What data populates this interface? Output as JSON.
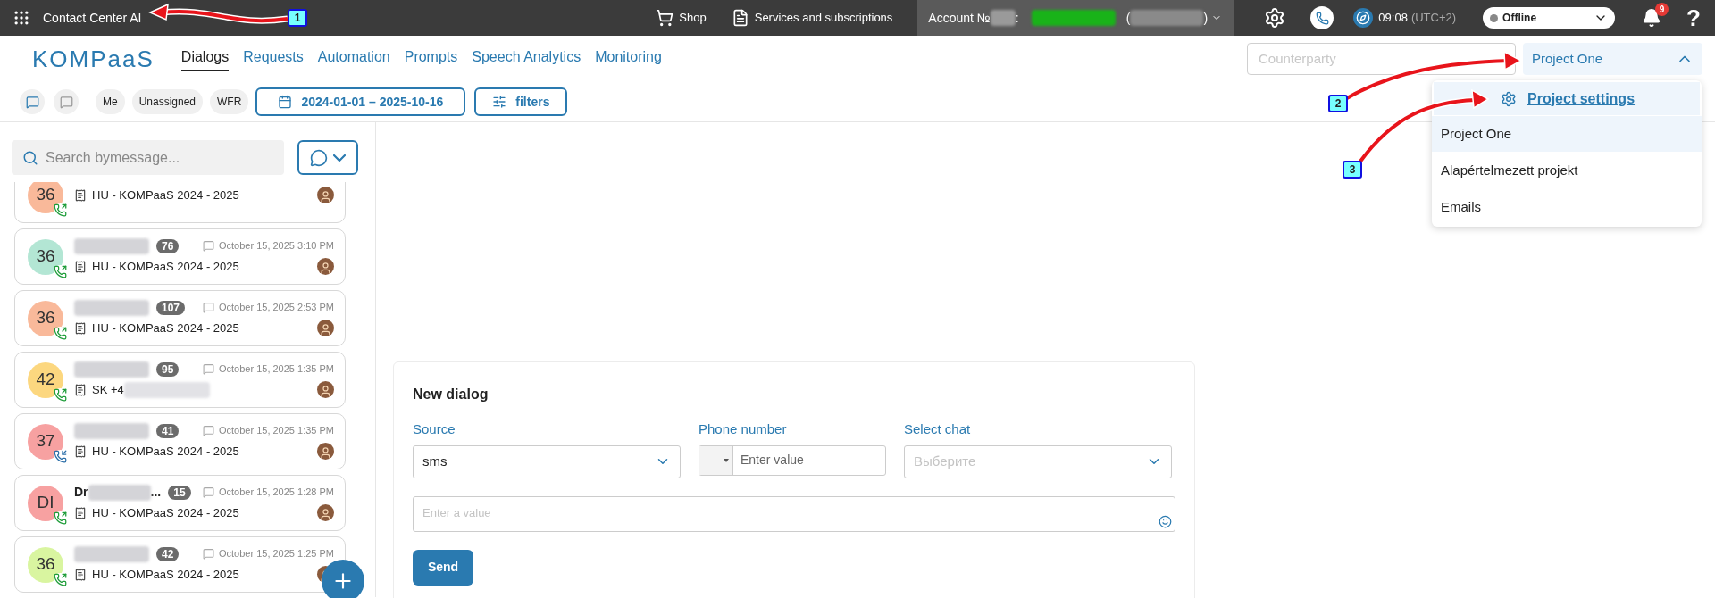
{
  "top_bar": {
    "app_title": "Contact Center AI",
    "links": [
      {
        "label": "Shop",
        "kind": "cart"
      },
      {
        "label": "Services and subscriptions",
        "kind": "services"
      }
    ],
    "account_label": "Account №",
    "account_colon": ":",
    "paren_open": "(",
    "paren_close": ")",
    "time": "09:08",
    "timezone": "(UTC+2)",
    "status": "Offline",
    "notifications": "9",
    "help": "?"
  },
  "nav": {
    "logo": "KOMPaaS",
    "tabs": [
      {
        "label": "Dialogs",
        "selected": true
      },
      {
        "label": "Requests",
        "selected": false
      },
      {
        "label": "Automation",
        "selected": false
      },
      {
        "label": "Prompts",
        "selected": false
      },
      {
        "label": "Speech Analytics",
        "selected": false
      },
      {
        "label": "Monitoring",
        "selected": false
      }
    ],
    "counterparty_placeholder": "Counterparty",
    "project": {
      "value": "Project One",
      "expanded": true,
      "settings_label": "Project settings",
      "items": [
        {
          "label": "Project One",
          "selected": true
        },
        {
          "label": "Alapértelmezett projekt",
          "selected": false
        },
        {
          "label": "Emails",
          "selected": false
        }
      ]
    }
  },
  "filters": {
    "chips": [
      "Me",
      "Unassigned",
      "WFR"
    ],
    "date_range": "2024-01-01 – 2025-10-16",
    "filters_label": "filters"
  },
  "dialogs": {
    "search_placeholder": "Search bymessage...",
    "items": [
      {
        "avatar": "36",
        "color": "#f9b99a",
        "incoming": false,
        "subtitle": "HU - KOMPaaS 2024 - 2025"
      },
      {
        "avatar": "36",
        "color": "#b3e6d4",
        "incoming": false,
        "count": "76",
        "date": "October 15, 2025 3:10 PM",
        "subtitle": "HU - KOMPaaS 2024 - 2025"
      },
      {
        "avatar": "36",
        "color": "#f9b99a",
        "incoming": false,
        "count": "107",
        "date": "October 15, 2025 2:53 PM",
        "subtitle": "HU - KOMPaaS 2024 - 2025"
      },
      {
        "avatar": "42",
        "color": "#fcd77f",
        "incoming": false,
        "count": "95",
        "date": "October 15, 2025 1:35 PM",
        "subtitle": "SK +4",
        "subtitle_redacted": true
      },
      {
        "avatar": "37",
        "color": "#f7a1a1",
        "incoming": true,
        "count": "41",
        "date": "October 15, 2025 1:35 PM",
        "subtitle": "HU - KOMPaaS 2024 - 2025"
      },
      {
        "avatar": "DI",
        "color": "#f7a1a1",
        "incoming": false,
        "name_prefix": "Dr",
        "name_suffix": "...",
        "count": "15",
        "date": "October 15, 2025 1:28 PM",
        "subtitle": "HU - KOMPaaS 2024 - 2025"
      },
      {
        "avatar": "36",
        "color": "#d9f5a0",
        "incoming": false,
        "count": "42",
        "date": "October 15, 2025 1:25 PM",
        "subtitle": "HU - KOMPaaS 2024 - 2025"
      }
    ]
  },
  "new_dialog": {
    "title": "New dialog",
    "source_label": "Source",
    "source_value": "sms",
    "phone_label": "Phone number",
    "phone_placeholder": "Enter value",
    "chat_label": "Select chat",
    "chat_placeholder": "Выберите",
    "message_placeholder": "Enter a value",
    "send": "Send"
  },
  "annotations": [
    {
      "number": "1"
    },
    {
      "number": "2"
    },
    {
      "number": "3"
    }
  ]
}
